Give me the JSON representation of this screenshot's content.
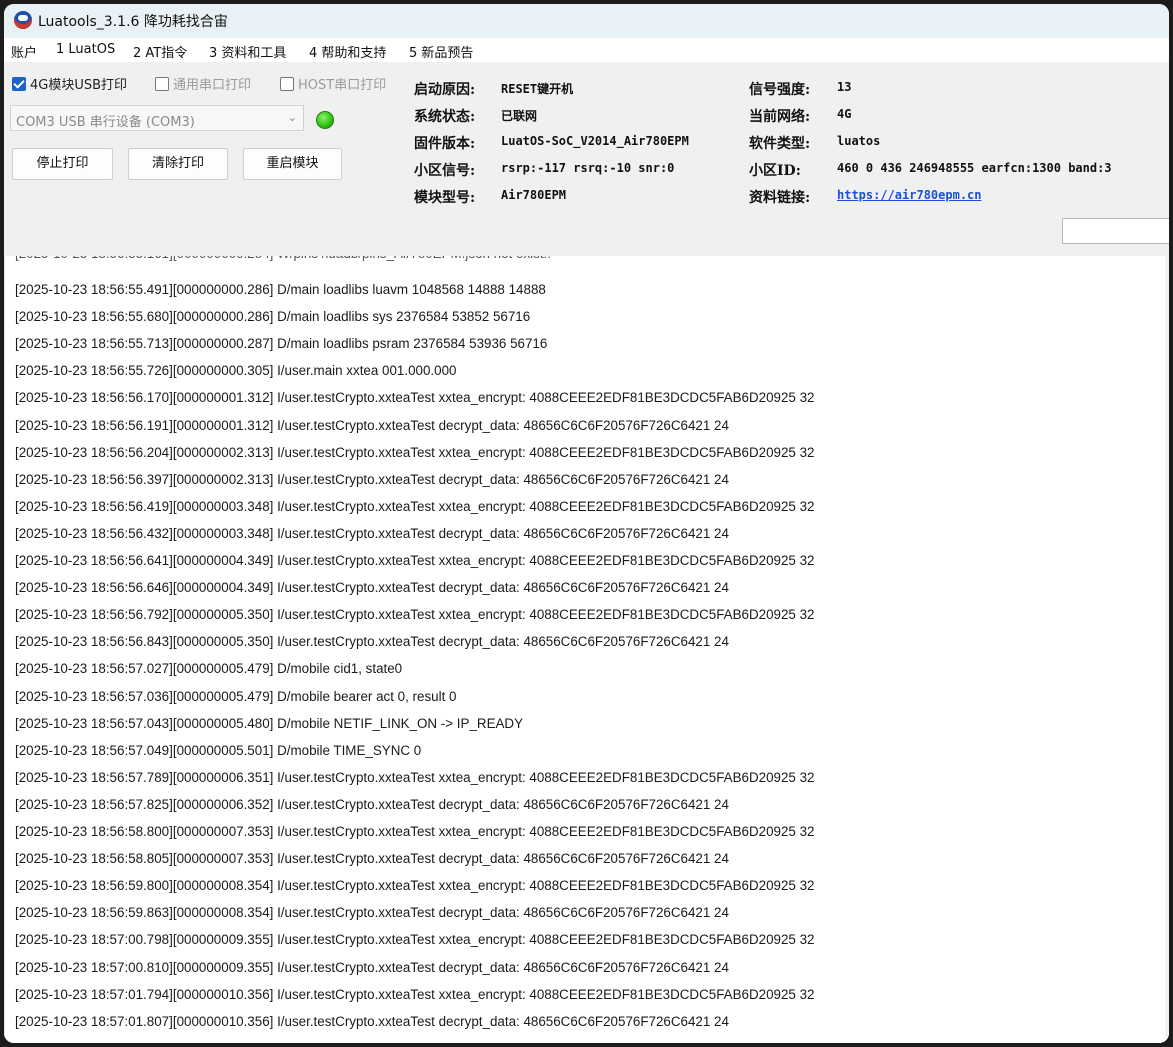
{
  "window": {
    "title": "Luatools_3.1.6 降功耗找合宙"
  },
  "menu": [
    "账户",
    "1 LuatOS",
    "2 AT指令",
    "3 资料和工具",
    "4 帮助和支持",
    "5 新品预告"
  ],
  "controls": {
    "chk_usb": "4G模块USB打印",
    "chk_serial": "通用串口打印",
    "chk_host": "HOST串口打印",
    "port_select": "COM3 USB 串行设备 (COM3)",
    "btn_stop": "停止打印",
    "btn_clear": "清除打印",
    "btn_restart": "重启模块",
    "status_color": "#31c613"
  },
  "info": {
    "boot_reason_label": "启动原因:",
    "boot_reason": "RESET键开机",
    "sys_state_label": "系统状态:",
    "sys_state": "已联网",
    "fw_label": "固件版本:",
    "fw": "LuatOS-SoC_V2014_Air780EPM",
    "cell_label": "小区信号:",
    "cell": "rsrp:-117 rsrq:-10 snr:0",
    "model_label": "模块型号:",
    "model": "Air780EPM",
    "signal_label": "信号强度:",
    "signal": "13",
    "network_label": "当前网络:",
    "network": "4G",
    "sw_label": "软件类型:",
    "sw": "luatos",
    "cellid_label": "小区ID:",
    "cellid": "460 0 436 246948555 earfcn:1300 band:3",
    "link_label": "资料链接:",
    "link": "https://air780epm.cn"
  },
  "log": [
    "[2025-10-23 18:56:55.491][000000000.286] D/main loadlibs luavm 1048568 14888 14888",
    "[2025-10-23 18:56:55.680][000000000.286] D/main loadlibs sys   2376584 53852 56716",
    "[2025-10-23 18:56:55.713][000000000.287] D/main loadlibs psram 2376584 53936 56716",
    "[2025-10-23 18:56:55.726][000000000.305] I/user.main xxtea 001.000.000",
    "[2025-10-23 18:56:56.170][000000001.312] I/user.testCrypto.xxteaTest xxtea_encrypt: 4088CEEE2EDF81BE3DCDC5FAB6D20925 32",
    "[2025-10-23 18:56:56.191][000000001.312] I/user.testCrypto.xxteaTest decrypt_data: 48656C6C6F20576F726C6421 24",
    "[2025-10-23 18:56:56.204][000000002.313] I/user.testCrypto.xxteaTest xxtea_encrypt: 4088CEEE2EDF81BE3DCDC5FAB6D20925 32",
    "[2025-10-23 18:56:56.397][000000002.313] I/user.testCrypto.xxteaTest decrypt_data: 48656C6C6F20576F726C6421 24",
    "[2025-10-23 18:56:56.419][000000003.348] I/user.testCrypto.xxteaTest xxtea_encrypt: 4088CEEE2EDF81BE3DCDC5FAB6D20925 32",
    "[2025-10-23 18:56:56.432][000000003.348] I/user.testCrypto.xxteaTest decrypt_data: 48656C6C6F20576F726C6421 24",
    "[2025-10-23 18:56:56.641][000000004.349] I/user.testCrypto.xxteaTest xxtea_encrypt: 4088CEEE2EDF81BE3DCDC5FAB6D20925 32",
    "[2025-10-23 18:56:56.646][000000004.349] I/user.testCrypto.xxteaTest decrypt_data: 48656C6C6F20576F726C6421 24",
    "[2025-10-23 18:56:56.792][000000005.350] I/user.testCrypto.xxteaTest xxtea_encrypt: 4088CEEE2EDF81BE3DCDC5FAB6D20925 32",
    "[2025-10-23 18:56:56.843][000000005.350] I/user.testCrypto.xxteaTest decrypt_data: 48656C6C6F20576F726C6421 24",
    "[2025-10-23 18:56:57.027][000000005.479] D/mobile cid1, state0",
    "[2025-10-23 18:56:57.036][000000005.479] D/mobile bearer act 0, result 0",
    "[2025-10-23 18:56:57.043][000000005.480] D/mobile NETIF_LINK_ON -> IP_READY",
    "[2025-10-23 18:56:57.049][000000005.501] D/mobile TIME_SYNC 0",
    "[2025-10-23 18:56:57.789][000000006.351] I/user.testCrypto.xxteaTest xxtea_encrypt: 4088CEEE2EDF81BE3DCDC5FAB6D20925 32",
    "[2025-10-23 18:56:57.825][000000006.352] I/user.testCrypto.xxteaTest decrypt_data: 48656C6C6F20576F726C6421 24",
    "[2025-10-23 18:56:58.800][000000007.353] I/user.testCrypto.xxteaTest xxtea_encrypt: 4088CEEE2EDF81BE3DCDC5FAB6D20925 32",
    "[2025-10-23 18:56:58.805][000000007.353] I/user.testCrypto.xxteaTest decrypt_data: 48656C6C6F20576F726C6421 24",
    "[2025-10-23 18:56:59.800][000000008.354] I/user.testCrypto.xxteaTest xxtea_encrypt: 4088CEEE2EDF81BE3DCDC5FAB6D20925 32",
    "[2025-10-23 18:56:59.863][000000008.354] I/user.testCrypto.xxteaTest decrypt_data: 48656C6C6F20576F726C6421 24",
    "[2025-10-23 18:57:00.798][000000009.355] I/user.testCrypto.xxteaTest xxtea_encrypt: 4088CEEE2EDF81BE3DCDC5FAB6D20925 32",
    "[2025-10-23 18:57:00.810][000000009.355] I/user.testCrypto.xxteaTest decrypt_data: 48656C6C6F20576F726C6421 24",
    "[2025-10-23 18:57:01.794][000000010.356] I/user.testCrypto.xxteaTest xxtea_encrypt: 4088CEEE2EDF81BE3DCDC5FAB6D20925 32",
    "[2025-10-23 18:57:01.807][000000010.356] I/user.testCrypto.xxteaTest decrypt_data: 48656C6C6F20576F726C6421 24"
  ]
}
